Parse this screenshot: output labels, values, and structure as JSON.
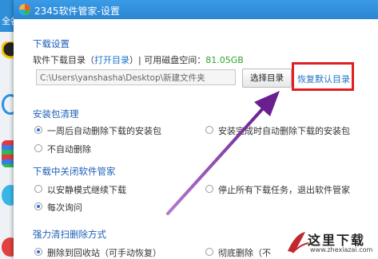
{
  "window": {
    "title": "2345软件管家-设置",
    "background_left_label": "全各"
  },
  "download": {
    "section_title": "下载设置",
    "dir_label": "软件下载目录（",
    "open_dir": "打开目录",
    "dir_sep": "）| 可用磁盘空间：",
    "free_space": "81.05GB",
    "path": "C:\\Users\\yanshasha\\Desktop\\新建文件夹",
    "browse_button": "选择目录",
    "restore_default": "恢复默认目录"
  },
  "package_cleanup": {
    "section_title": "安装包清理",
    "option_week": "一周后自动删除下载的安装包",
    "option_after_install": "安装完成时自动删除下载的安装包",
    "option_never": "不自动删除"
  },
  "close_behavior": {
    "section_title": "下载中关闭软件管家",
    "option_silent": "以安静模式继续下载",
    "option_stop": "停止所有下载任务，退出软件管家",
    "option_ask": "每次询问"
  },
  "force_delete": {
    "section_title": "强力清扫删除方式",
    "option_recycle": "删除到回收站（可手动恢复）",
    "option_permanent": "彻底删除（不"
  },
  "watermark": {
    "text": "这里下载",
    "url": "www.zhexiazai.com"
  },
  "colors": {
    "title_bar": "#2a85d2",
    "section_title": "#1f5fb8",
    "link": "#1f73c9",
    "free_space": "#2ea42e",
    "highlight_box": "#e02020",
    "arrow": "#7a2a9a"
  },
  "radio_state": {
    "package_cleanup": "option_week",
    "close_behavior": "option_ask",
    "force_delete": "option_recycle"
  }
}
